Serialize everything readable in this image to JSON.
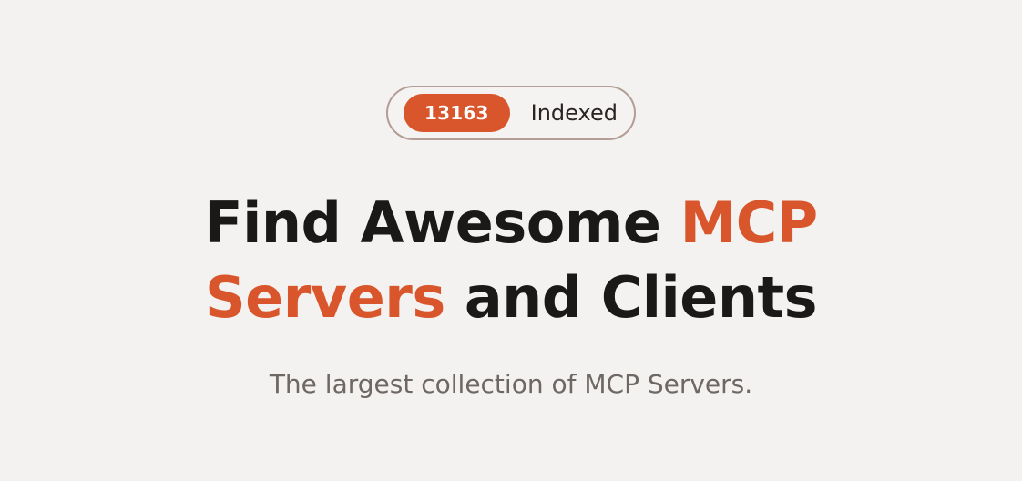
{
  "badge": {
    "count": "13163",
    "label": "Indexed"
  },
  "headline": {
    "line1_plain": "Find Awesome ",
    "line1_accent": "MCP",
    "line2_accent": "Servers",
    "line2_plain": " and Clients"
  },
  "subtitle": "The largest collection of MCP Servers.",
  "colors": {
    "accent": "#d9552b",
    "background": "#f3f2f0",
    "heading": "#1b1918",
    "subtitle": "#6f6764",
    "badge_border": "#b49d94"
  }
}
